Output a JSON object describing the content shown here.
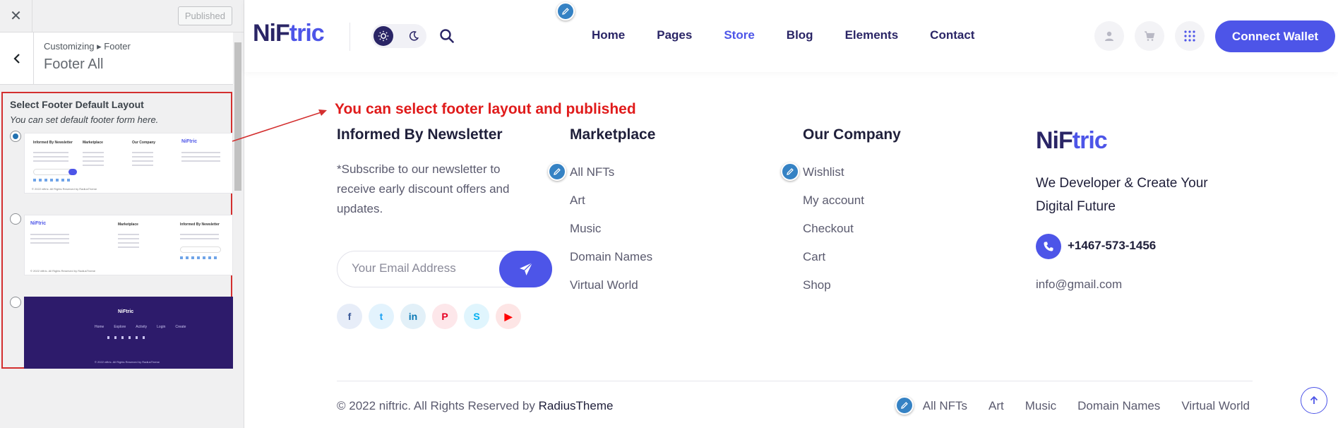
{
  "panel": {
    "close_icon": "close-icon",
    "published_label": "Published",
    "back_icon": "chevron-left-icon",
    "breadcrumb": "Customizing ▸ Footer",
    "title": "Footer All",
    "layout_title": "Select Footer Default Layout",
    "layout_desc": "You can set default footer form here.",
    "previews": [
      {
        "selected": true,
        "columns": [
          "Informed By Newsletter",
          "Marketplace",
          "Our Company",
          "NiFtric"
        ],
        "copyright": "© 2022 niftric. All Rights Reserved by RadiusTheme"
      },
      {
        "selected": false,
        "columns": [
          "NiFtric",
          "Marketplace",
          "Informed By Newsletter"
        ],
        "copyright": "© 2022 niftric. All Rights Reserved by RadiusTheme"
      },
      {
        "selected": false,
        "brand": "NiFtric",
        "nav": [
          "Home",
          "Explore",
          "Activity",
          "Login",
          "Create"
        ],
        "copyright": "© 2022 niftric. All Rights Reserved by RadiusTheme"
      }
    ]
  },
  "header": {
    "logo_part1": "NiF",
    "logo_part2": "tric",
    "nav": [
      {
        "label": "Home",
        "active": false
      },
      {
        "label": "Pages",
        "active": false
      },
      {
        "label": "Store",
        "active": true
      },
      {
        "label": "Blog",
        "active": false
      },
      {
        "label": "Elements",
        "active": false
      },
      {
        "label": "Contact",
        "active": false
      }
    ],
    "connect_label": "Connect Wallet"
  },
  "annotation": "You can select footer layout and published",
  "footer": {
    "newsletter": {
      "title": "Informed By Newsletter",
      "text": "*Subscribe to our newsletter to receive early discount offers and updates.",
      "placeholder": "Your Email Address"
    },
    "marketplace": {
      "title": "Marketplace",
      "links": [
        "All NFTs",
        "Art",
        "Music",
        "Domain Names",
        "Virtual World"
      ]
    },
    "company": {
      "title": "Our Company",
      "links": [
        "Wishlist",
        "My account",
        "Checkout",
        "Cart",
        "Shop"
      ]
    },
    "brand": {
      "logo_part1": "NiF",
      "logo_part2": "tric",
      "tagline": "We Developer & Create Your Digital Future",
      "phone": "+1467-573-1456",
      "email": "info@gmail.com"
    },
    "social": [
      {
        "name": "facebook-icon",
        "glyph": "f",
        "color": "#3b5998",
        "bg": "#e7edf8"
      },
      {
        "name": "twitter-icon",
        "glyph": "t",
        "color": "#1da1f2",
        "bg": "#e3f3fd"
      },
      {
        "name": "linkedin-icon",
        "glyph": "in",
        "color": "#0a78b5",
        "bg": "#e2f0f8"
      },
      {
        "name": "pinterest-icon",
        "glyph": "P",
        "color": "#e60023",
        "bg": "#fde7ea"
      },
      {
        "name": "skype-icon",
        "glyph": "S",
        "color": "#00aff0",
        "bg": "#e0f5fd"
      },
      {
        "name": "youtube-icon",
        "glyph": "▶",
        "color": "#ff0000",
        "bg": "#fde5e5"
      }
    ],
    "copyright_prefix": "© 2022 niftric. All Rights Reserved by ",
    "copyright_brand": "RadiusTheme",
    "bottom_links": [
      "All NFTs",
      "Art",
      "Music",
      "Domain Names",
      "Virtual World"
    ]
  },
  "colors": {
    "accent": "#4d55e8",
    "navy": "#2a2566",
    "annotation": "#e01b1b"
  }
}
